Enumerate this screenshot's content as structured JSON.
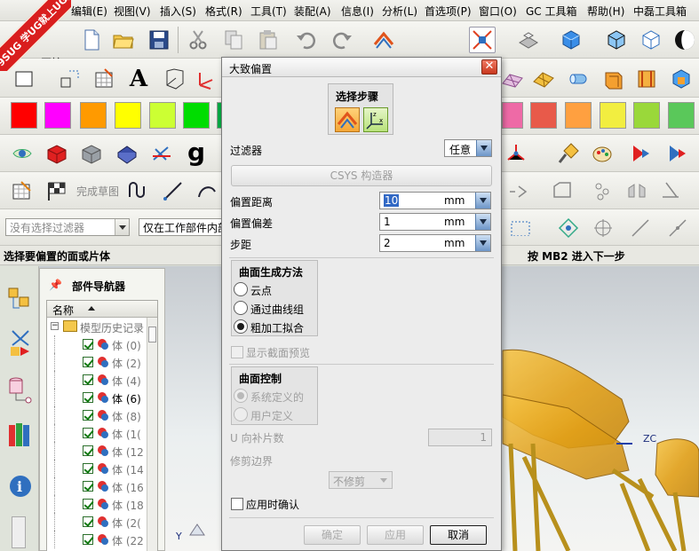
{
  "logo": {
    "text": "9SUG 学UG就上UG网"
  },
  "menu": [
    "编辑(E)",
    "视图(V)",
    "插入(S)",
    "格式(R)",
    "工具(T)",
    "装配(A)",
    "信息(I)",
    "分析(L)",
    "首选项(P)",
    "窗口(O)",
    "GC 工具箱",
    "帮助(H)",
    "中磊工具箱"
  ],
  "toolbar": {
    "start_label": "开始",
    "sketch_label": "完成草图",
    "filter_dropdown": "没有选择过滤器",
    "scope_dropdown": "仅在工作部件内部"
  },
  "colors": [
    "#ff0000",
    "#ff00ff",
    "#ff9a00",
    "#ffff00",
    "#ccff33",
    "#00dd00",
    "#00aa44",
    "#ee6aa6",
    "#e85a4a",
    "#ffa040",
    "#f2ee40",
    "#9ad83a",
    "#5ac85a"
  ],
  "status": {
    "prompt": "选择要偏置的面或片体",
    "hint": "按 MB2 进入下一步"
  },
  "navigator": {
    "title": "部件导航器",
    "column": "名称",
    "root": "模型历史记录",
    "items": [
      {
        "label": "体 (0)",
        "active": false
      },
      {
        "label": "体 (2)",
        "active": false
      },
      {
        "label": "体 (4)",
        "active": false
      },
      {
        "label": "体 (6)",
        "active": true
      },
      {
        "label": "体 (8)",
        "active": false
      },
      {
        "label": "体 (1(",
        "active": false
      },
      {
        "label": "体 (12",
        "active": false
      },
      {
        "label": "体 (14",
        "active": false
      },
      {
        "label": "体 (16",
        "active": false
      },
      {
        "label": "体 (18",
        "active": false
      },
      {
        "label": "体 (2(",
        "active": false
      },
      {
        "label": "体 (22",
        "active": false
      }
    ]
  },
  "dialog": {
    "title": "大致偏置",
    "close_glyph": "✕",
    "step_title": "选择步骤",
    "filter_label": "过滤器",
    "filter_value": "任意",
    "csys_button": "CSYS 构造器",
    "offset_distance": {
      "label": "偏置距离",
      "value": "10",
      "unit": "mm"
    },
    "offset_deviation": {
      "label": "偏置偏差",
      "value": "1",
      "unit": "mm"
    },
    "step": {
      "label": "步距",
      "value": "2",
      "unit": "mm"
    },
    "surface_method": {
      "title": "曲面生成方法",
      "options": [
        "云点",
        "通过曲线组",
        "粗加工拟合"
      ],
      "selected": "粗加工拟合"
    },
    "show_preview": "显示截面预览",
    "surface_control": {
      "title": "曲面控制",
      "options": [
        "系统定义的",
        "用户定义"
      ],
      "selected": "系统定义的"
    },
    "u_patches": {
      "label": "U 向补片数",
      "value": "1"
    },
    "trim_label": "修剪边界",
    "trim_value": "不修剪",
    "confirm_label": "应用时确认",
    "buttons": {
      "ok": "确定",
      "apply": "应用",
      "cancel": "取消"
    }
  },
  "viewport": {
    "axis_zc": "ZC",
    "axis_y": "Y"
  }
}
